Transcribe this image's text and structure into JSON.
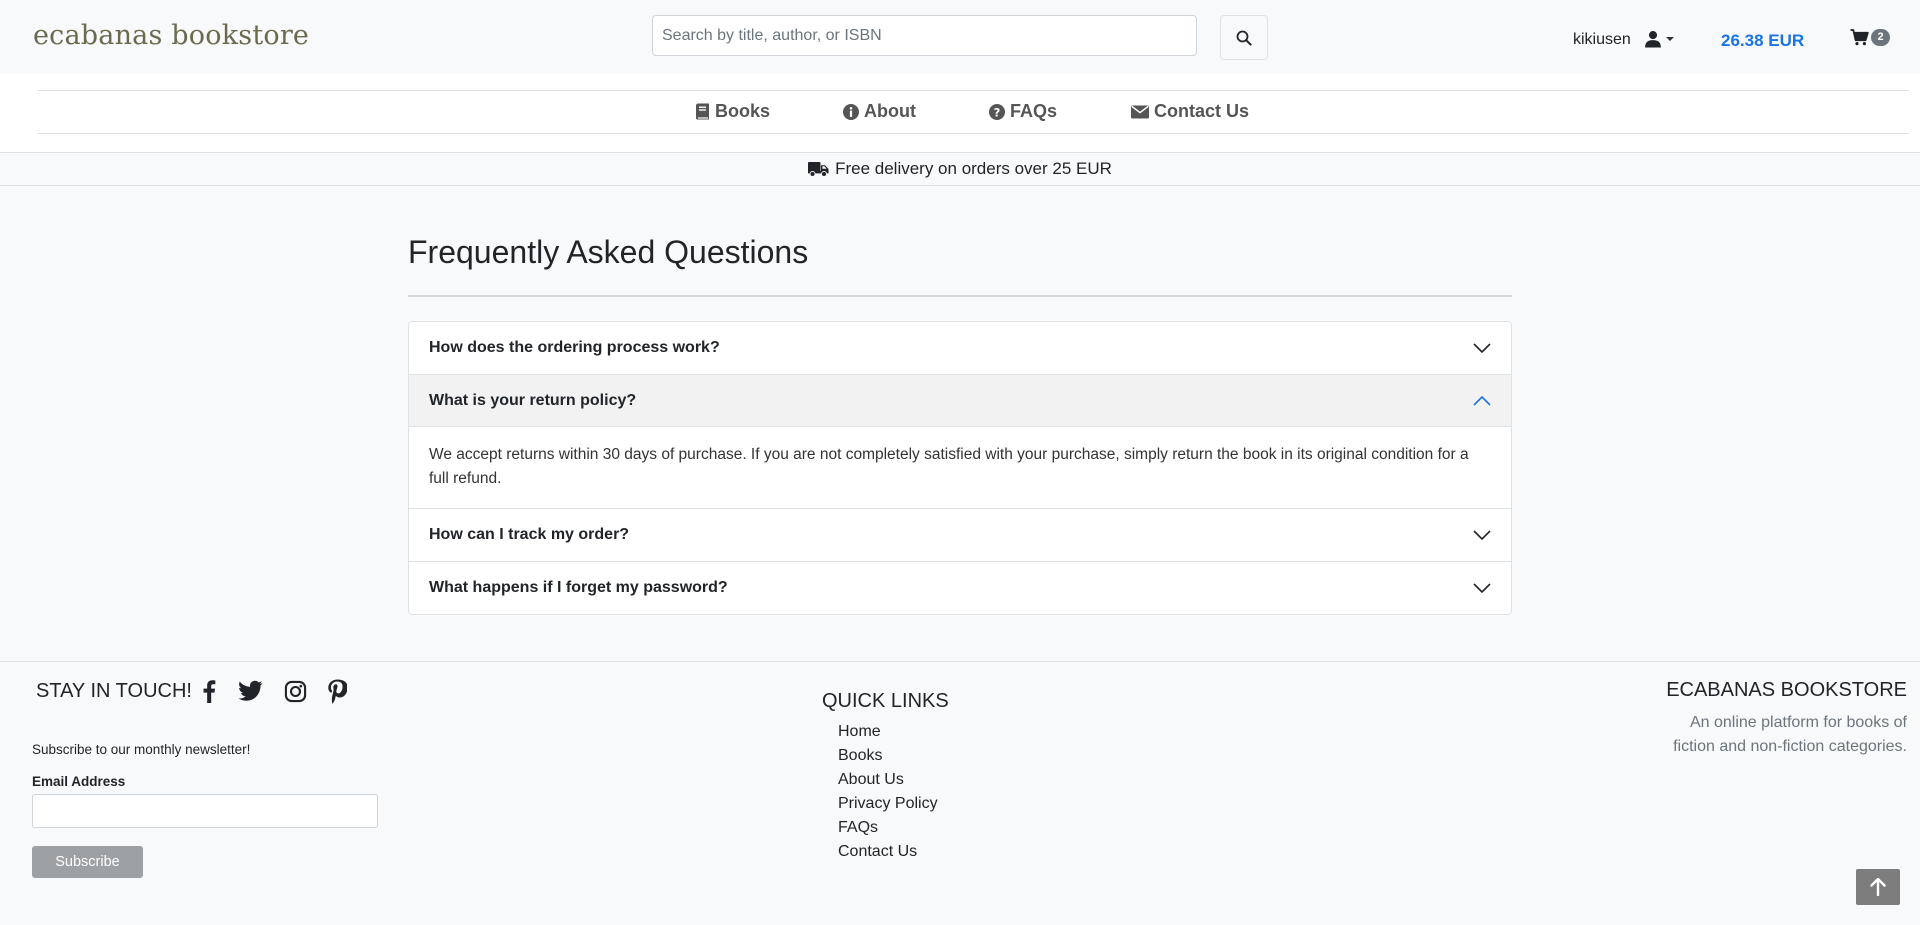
{
  "header": {
    "brand": "ecabanas bookstore",
    "search_placeholder": "Search by title, author, or ISBN",
    "search_value": "",
    "username": "kikiusen",
    "balance": "26.38 EUR",
    "cart_count": "2"
  },
  "nav": {
    "items": [
      {
        "label": "Books",
        "icon": "book-icon"
      },
      {
        "label": "About",
        "icon": "info-circle-icon"
      },
      {
        "label": "FAQs",
        "icon": "question-circle-icon"
      },
      {
        "label": "Contact Us",
        "icon": "envelope-icon"
      }
    ]
  },
  "promo": {
    "text": "Free delivery on orders over 25 EUR",
    "icon": "truck-icon"
  },
  "faq": {
    "title": "Frequently Asked Questions",
    "items": [
      {
        "question": "How does the ordering process work?",
        "expanded": false
      },
      {
        "question": "What is your return policy?",
        "expanded": true,
        "answer": "We accept returns within 30 days of purchase. If you are not completely satisfied with your purchase, simply return the book in its original condition for a full refund."
      },
      {
        "question": "How can I track my order?",
        "expanded": false
      },
      {
        "question": "What happens if I forget my password?",
        "expanded": false
      }
    ]
  },
  "footer": {
    "stay_title": "STAY IN TOUCH!",
    "social_icons": [
      "facebook-icon",
      "twitter-icon",
      "instagram-icon",
      "pinterest-icon"
    ],
    "newsletter_text": "Subscribe to our monthly newsletter!",
    "email_label": "Email Address",
    "email_value": "",
    "subscribe_label": "Subscribe",
    "quick_links_title": "QUICK LINKS",
    "quick_links": [
      "Home",
      "Books",
      "About Us",
      "Privacy Policy",
      "FAQs",
      "Contact Us"
    ],
    "store_title": "ECABANAS BOOKSTORE",
    "store_desc": "An online platform for books of fiction and non-fiction categories."
  },
  "colors": {
    "brand": "#6b6a4f",
    "accent": "#1a73e8",
    "page_background": "#f8f9fa",
    "subscribe_button": "#9ea1a4"
  }
}
